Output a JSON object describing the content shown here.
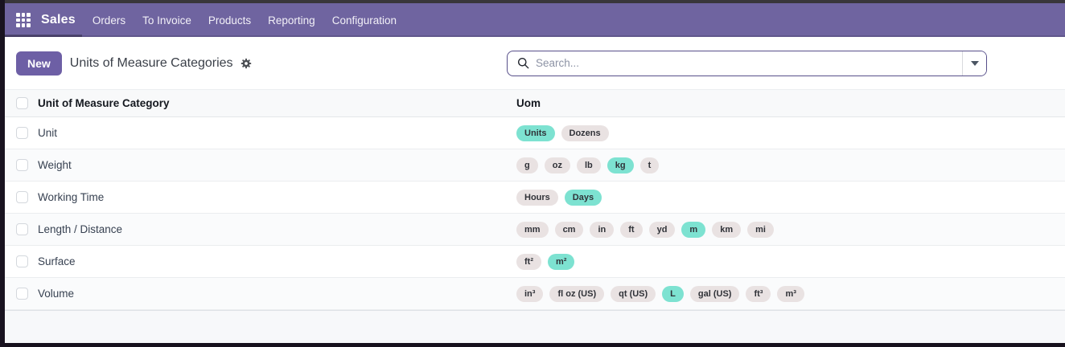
{
  "navbar": {
    "brand": "Sales",
    "items": [
      {
        "label": "Orders"
      },
      {
        "label": "To Invoice"
      },
      {
        "label": "Products"
      },
      {
        "label": "Reporting"
      },
      {
        "label": "Configuration"
      }
    ]
  },
  "control_bar": {
    "new_button_label": "New",
    "page_title": "Units of Measure Categories"
  },
  "search": {
    "placeholder": "Search...",
    "value": ""
  },
  "table": {
    "columns": [
      {
        "label": "Unit of Measure Category"
      },
      {
        "label": "Uom"
      }
    ],
    "rows": [
      {
        "category": "Unit",
        "uoms": [
          {
            "label": "Units",
            "highlighted": true
          },
          {
            "label": "Dozens",
            "highlighted": false
          }
        ]
      },
      {
        "category": "Weight",
        "uoms": [
          {
            "label": "g",
            "highlighted": false
          },
          {
            "label": "oz",
            "highlighted": false
          },
          {
            "label": "lb",
            "highlighted": false
          },
          {
            "label": "kg",
            "highlighted": true
          },
          {
            "label": "t",
            "highlighted": false
          }
        ]
      },
      {
        "category": "Working Time",
        "uoms": [
          {
            "label": "Hours",
            "highlighted": false
          },
          {
            "label": "Days",
            "highlighted": true
          }
        ]
      },
      {
        "category": "Length / Distance",
        "uoms": [
          {
            "label": "mm",
            "highlighted": false
          },
          {
            "label": "cm",
            "highlighted": false
          },
          {
            "label": "in",
            "highlighted": false
          },
          {
            "label": "ft",
            "highlighted": false
          },
          {
            "label": "yd",
            "highlighted": false
          },
          {
            "label": "m",
            "highlighted": true
          },
          {
            "label": "km",
            "highlighted": false
          },
          {
            "label": "mi",
            "highlighted": false
          }
        ]
      },
      {
        "category": "Surface",
        "uoms": [
          {
            "label": "ft²",
            "highlighted": false
          },
          {
            "label": "m²",
            "highlighted": true
          }
        ]
      },
      {
        "category": "Volume",
        "uoms": [
          {
            "label": "in³",
            "highlighted": false
          },
          {
            "label": "fl oz (US)",
            "highlighted": false
          },
          {
            "label": "qt (US)",
            "highlighted": false
          },
          {
            "label": "L",
            "highlighted": true
          },
          {
            "label": "gal (US)",
            "highlighted": false
          },
          {
            "label": "ft³",
            "highlighted": false
          },
          {
            "label": "m³",
            "highlighted": false
          }
        ]
      }
    ]
  },
  "colors": {
    "navbar_purple": "#6f64a0",
    "accent_purple": "#6d5fa5",
    "badge_teal": "#7de2d1",
    "badge_gray": "#e9e2e2"
  }
}
